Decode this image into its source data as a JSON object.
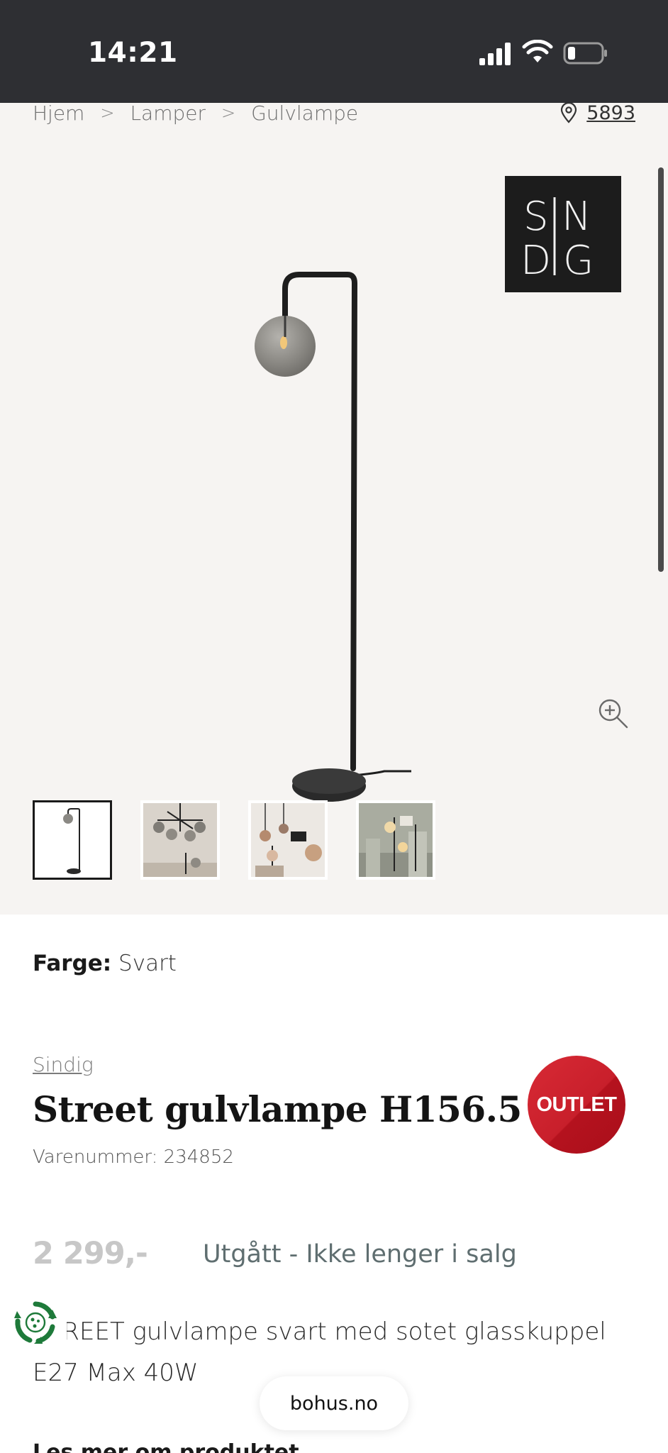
{
  "status_bar": {
    "time": "14:21"
  },
  "breadcrumb": {
    "items": [
      "Hjem",
      "Lamper",
      "Gulvlampe"
    ],
    "separator": ">"
  },
  "store": {
    "number": "5893"
  },
  "brand_logo": {
    "text": "SINDIG"
  },
  "gallery": {
    "thumbnail_count": 4,
    "active_index": 0
  },
  "product": {
    "color_label": "Farge:",
    "color_value": "Svart",
    "brand": "Sindig",
    "title": "Street gulvlampe H156.5",
    "sku": "Varenummer: 234852",
    "badge": "OUTLET",
    "price": "2 299,-",
    "availability": "Utgått - Ikke lenger i salg",
    "description": "STREET gulvlampe svart med sotet glasskuppel E27 Max 40W",
    "read_more": "Les mer om produktet"
  },
  "browser": {
    "domain": "bohus.no"
  },
  "colors": {
    "status_bar": "#2e2f33",
    "gallery_bg": "#f6f4f2",
    "badge_red": "#c81f2b",
    "availability": "#5f6e70",
    "eco_green": "#1e7a3a"
  }
}
